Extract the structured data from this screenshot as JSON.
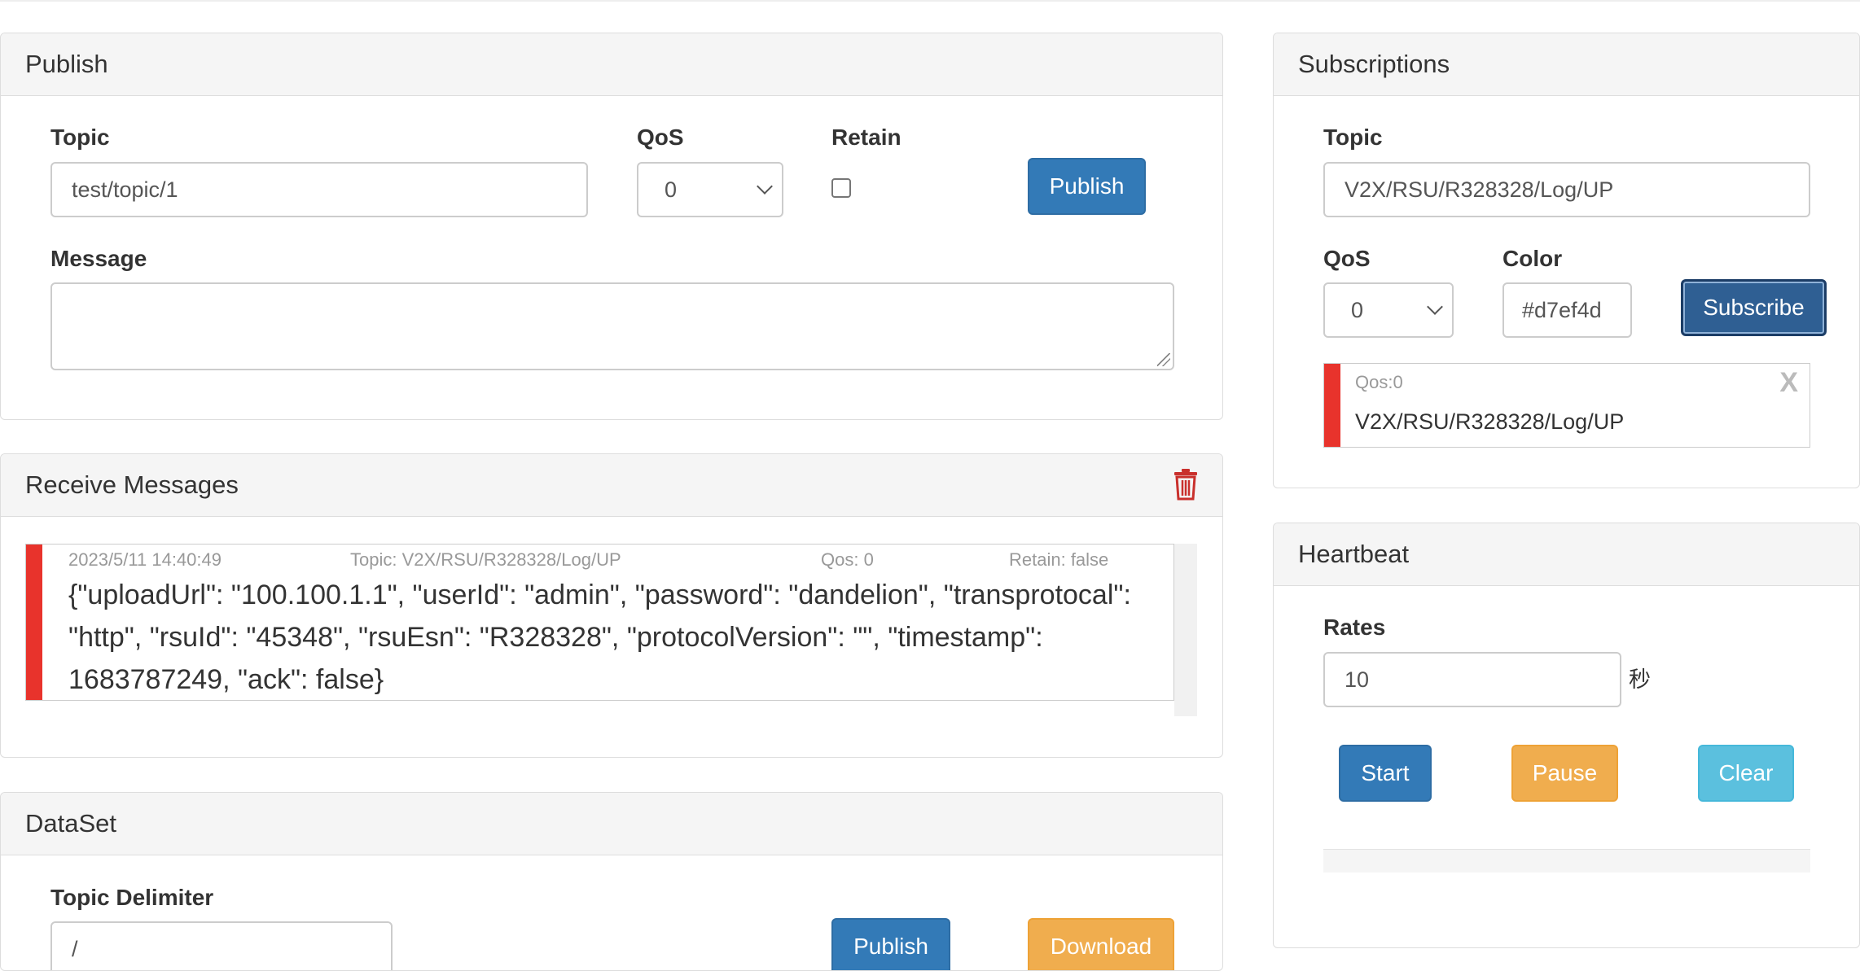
{
  "publish": {
    "title": "Publish",
    "topic_label": "Topic",
    "topic_value": "test/topic/1",
    "qos_label": "QoS",
    "qos_value": "0",
    "retain_label": "Retain",
    "publish_button": "Publish",
    "message_label": "Message",
    "message_value": ""
  },
  "receive": {
    "title": "Receive Messages",
    "messages": [
      {
        "time": "2023/5/11 14:40:49",
        "topic": "Topic: V2X/RSU/R328328/Log/UP",
        "qos": "Qos: 0",
        "retain": "Retain: false",
        "body": "{\"uploadUrl\": \"100.100.1.1\", \"userId\": \"admin\", \"password\": \"dandelion\", \"transprotocal\": \"http\", \"rsuId\": \"45348\", \"rsuEsn\": \"R328328\", \"protocolVersion\": \"\", \"timestamp\": 1683787249, \"ack\": false}",
        "color": "#e8332c"
      }
    ]
  },
  "dataset": {
    "title": "DataSet",
    "delimiter_label": "Topic Delimiter",
    "delimiter_value": "/",
    "publish_button": "Publish",
    "download_button": "Download"
  },
  "subscriptions": {
    "title": "Subscriptions",
    "topic_label": "Topic",
    "topic_value": "V2X/RSU/R328328/Log/UP",
    "qos_label": "QoS",
    "qos_value": "0",
    "color_label": "Color",
    "color_value": "#d7ef4d",
    "subscribe_button": "Subscribe",
    "items": [
      {
        "qos": "Qos:0",
        "topic": "V2X/RSU/R328328/Log/UP",
        "color": "#e8332c",
        "close": "X"
      }
    ]
  },
  "heartbeat": {
    "title": "Heartbeat",
    "rates_label": "Rates",
    "rates_value": "10",
    "unit": "秒",
    "start_button": "Start",
    "pause_button": "Pause",
    "clear_button": "Clear"
  }
}
